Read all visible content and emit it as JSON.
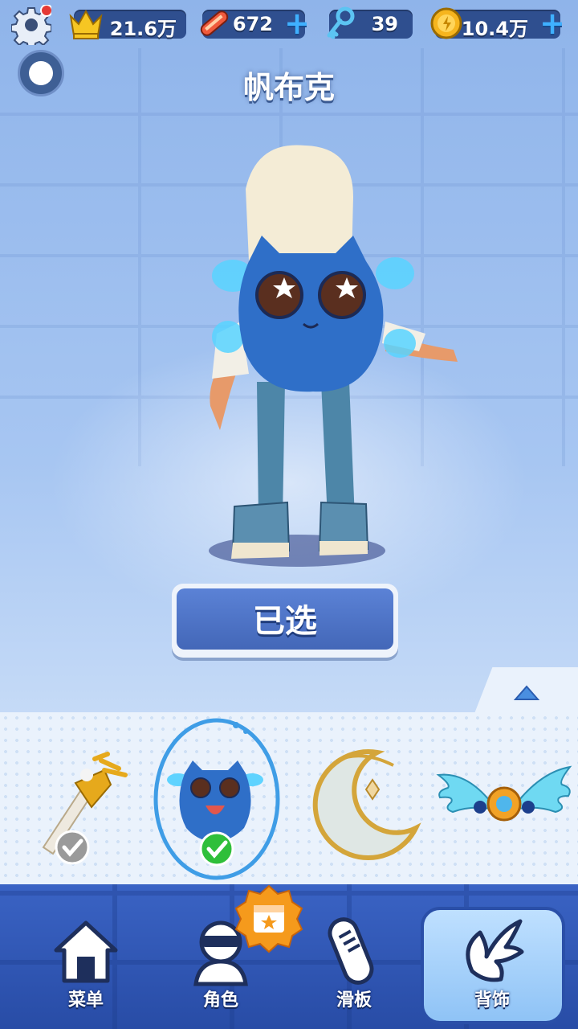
{
  "top_bar": {
    "crowns": "21.6万",
    "boards": "672",
    "keys": "39",
    "coins": "10.4万",
    "add_symbol": "+"
  },
  "title": "帆布克",
  "select_button": "已选",
  "nav": {
    "menu": "菜单",
    "character": "角色",
    "board": "滑板",
    "backpack": "背饰"
  },
  "colors": {
    "accent": "#3fb0ff",
    "nav_bg": "#2f56b6",
    "button_blue": "#4d74c8",
    "check_green": "#2fbf3a"
  },
  "items": [
    {
      "icon": "golden-torch-icon",
      "state": "owned"
    },
    {
      "icon": "blue-creature-backpack-icon",
      "state": "selected"
    },
    {
      "icon": "crescent-moon-backpack-icon",
      "state": "none"
    },
    {
      "icon": "crystal-wings-backpack-icon",
      "state": "none"
    }
  ]
}
